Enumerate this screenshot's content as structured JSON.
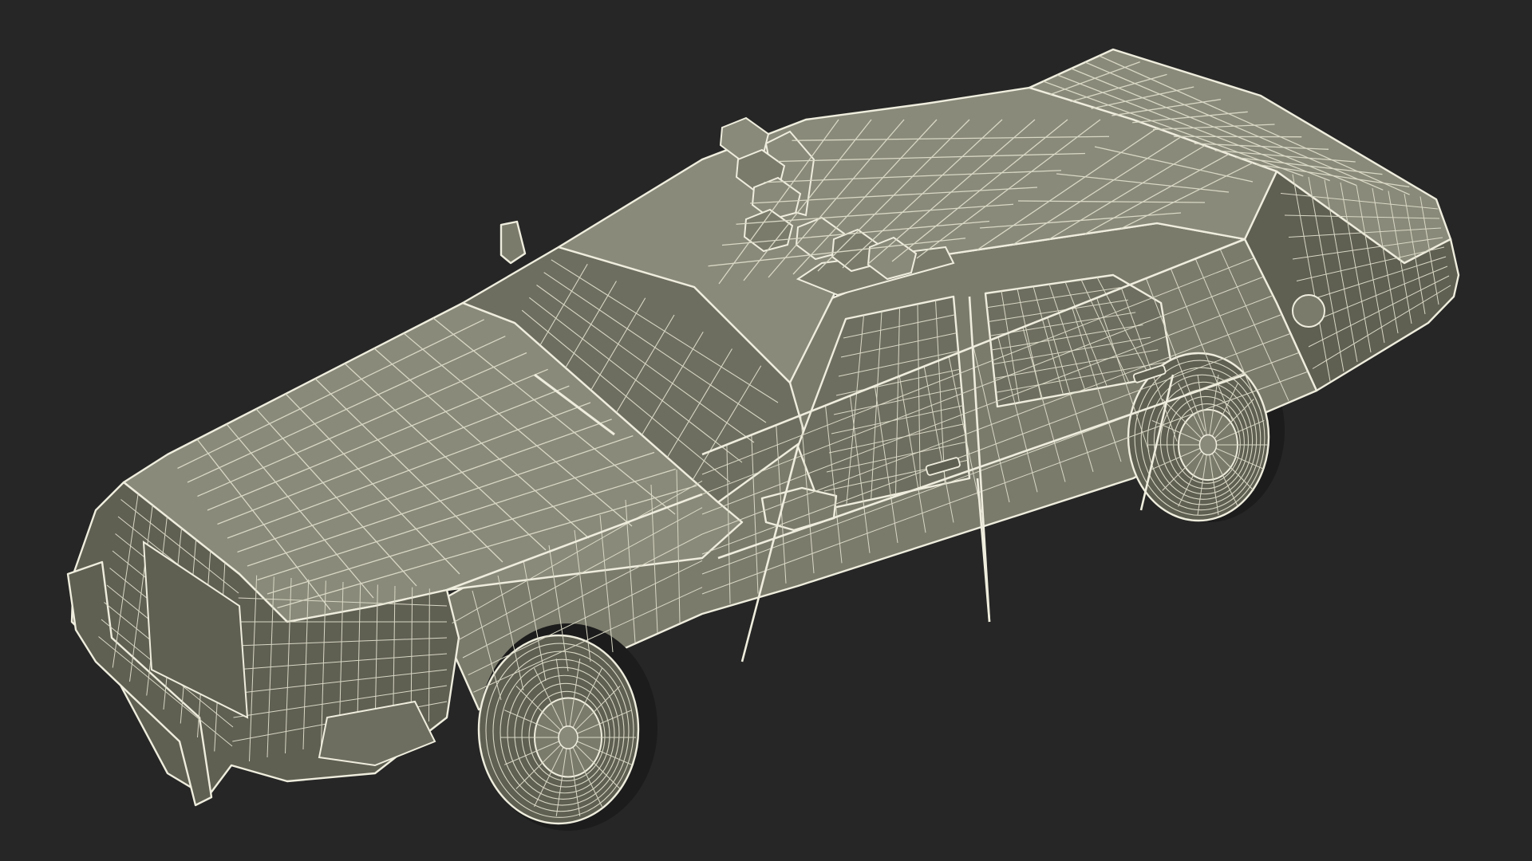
{
  "scene": {
    "subject": "sedan-wireframe-model",
    "render_mode": "wireframe-over-shaded",
    "colors": {
      "background": "#262626",
      "body_fill": "#7b7b6c",
      "body_fill_light": "#8a8a7a",
      "body_fill_dark": "#5f5f52",
      "glass_fill": "#6e6e60",
      "wire": "#efeede",
      "wire_soft": "#d9d8c6",
      "shadow": "#1c1c1c"
    }
  }
}
